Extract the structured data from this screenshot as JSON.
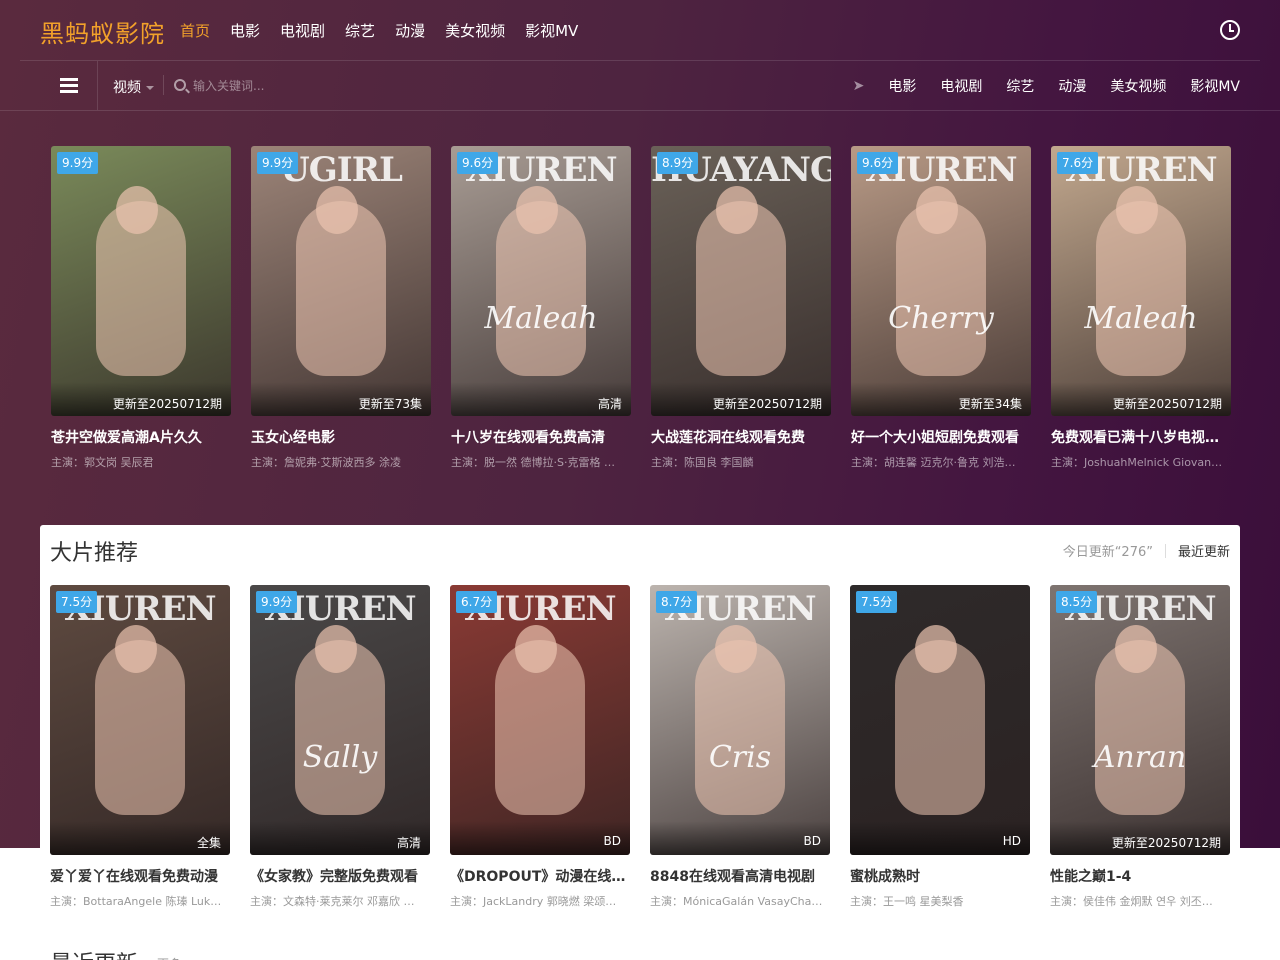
{
  "header": {
    "logo": "黑蚂蚁影院",
    "nav": [
      "首页",
      "电影",
      "电视剧",
      "综艺",
      "动漫",
      "美女视频",
      "影视MV"
    ],
    "history_icon": "clock-icon"
  },
  "subbar": {
    "select_value": "视频",
    "search_placeholder": "输入关键词...",
    "nav": [
      "电影",
      "电视剧",
      "综艺",
      "动漫",
      "美女视频",
      "影视MV"
    ],
    "menu_icon": "hamburger-icon",
    "send_icon": "paper-plane-icon"
  },
  "hero_cards": [
    {
      "score": "9.9分",
      "status": "更新至20250712期",
      "title": "苍井空做爱高潮A片久久",
      "actors": "主演：郭文岗 吴辰君",
      "watermark": "",
      "script": "",
      "bg": "#7a8a5a"
    },
    {
      "score": "9.9分",
      "status": "更新至73集",
      "title": "玉女心经电影",
      "actors": "主演：詹妮弗·艾斯波西多 涂凌",
      "watermark": "UGIRL",
      "script": "",
      "bg": "#9c8478"
    },
    {
      "score": "9.6分",
      "status": "高清",
      "title": "十八岁在线观看免费高清",
      "actors": "主演：脱一然 德博拉·S·克雷格 …",
      "watermark": "XIUREN",
      "script": "Maleah",
      "bg": "#a89c94"
    },
    {
      "score": "8.9分",
      "status": "更新至20250712期",
      "title": "大战莲花洞在线观看免费",
      "actors": "主演：陈国良 李国麟",
      "watermark": "HUAYANG",
      "script": "",
      "bg": "#6a6158"
    },
    {
      "score": "9.6分",
      "status": "更新至34集",
      "title": "好一个大小姐短剧免费观看",
      "actors": "主演：胡连馨 迈克尔·鲁克 刘浩…",
      "watermark": "XIUREN",
      "script": "Cherry",
      "bg": "#b89a86"
    },
    {
      "score": "7.6分",
      "status": "更新至20250712期",
      "title": "免费观看已满十八岁电视…",
      "actors": "主演：JoshuahMelnick Giovan…",
      "watermark": "XIUREN",
      "script": "Maleah",
      "bg": "#c2a88e"
    }
  ],
  "recommend": {
    "title": "大片推荐",
    "count": "今日更新“276”",
    "more": "最近更新",
    "cards": [
      {
        "score": "7.5分",
        "status": "全集",
        "title": "爱丫爱丫在线观看免费动漫",
        "actors": "主演：BottaraAngele 陈瑧 Luk…",
        "watermark": "XIUREN",
        "script": "",
        "bg": "#5e4a40"
      },
      {
        "score": "9.9分",
        "status": "高清",
        "title": "《女家教》完整版免费观看",
        "actors": "主演：文森特·莱克莱尔 邓嘉欣 …",
        "watermark": "XIUREN",
        "script": "Sally",
        "bg": "#4a4848"
      },
      {
        "score": "6.7分",
        "status": "BD",
        "title": "《DROPOUT》动漫在线…",
        "actors": "主演：JackLandry 郭晓燃 梁颂…",
        "watermark": "XIUREN",
        "script": "",
        "bg": "#8a3a34"
      },
      {
        "score": "8.7分",
        "status": "BD",
        "title": "8848在线观看高清电视剧",
        "actors": "主演：MónicaGalán VasayCha…",
        "watermark": "XIUREN",
        "script": "Cris",
        "bg": "#bcb4ae"
      },
      {
        "score": "7.5分",
        "status": "HD",
        "title": "蜜桃成熟时",
        "actors": "主演：王一鸣 星美梨香",
        "watermark": "",
        "script": "",
        "bg": "#2e2a2a"
      },
      {
        "score": "8.5分",
        "status": "更新至20250712期",
        "title": "性能之巅1-4",
        "actors": "主演：侯佳伟 金炯默 연우 刘丕…",
        "watermark": "XIUREN",
        "script": "Anran",
        "bg": "#7e7470"
      }
    ]
  },
  "next_section": {
    "title": "最近更新",
    "sub": "更多"
  }
}
